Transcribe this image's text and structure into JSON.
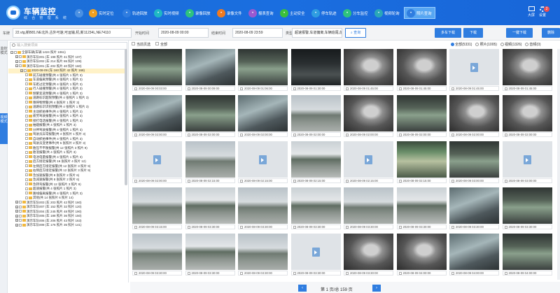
{
  "header": {
    "title": "车辆监控",
    "subtitle": "综 合 管 理 系 统",
    "nav": [
      {
        "label": "",
        "icon": "grid-icon",
        "color": "#4a90e2"
      },
      {
        "label": "实时定位",
        "icon": "location-pin-icon",
        "color": "#f0a020"
      },
      {
        "label": "轨迹回放",
        "icon": "track-icon",
        "color": "#2f7de0"
      },
      {
        "label": "实时视频",
        "icon": "play-icon",
        "color": "#1fb8c4"
      },
      {
        "label": "录像回放",
        "icon": "replay-icon",
        "color": "#2ec27e"
      },
      {
        "label": "录像文件",
        "icon": "file-icon",
        "color": "#f07a20"
      },
      {
        "label": "报表查询",
        "icon": "search-icon",
        "color": "#9b59d0"
      },
      {
        "label": "主动安全",
        "icon": "shield-icon",
        "color": "#3bbf3b"
      },
      {
        "label": "停车轨迹",
        "icon": "parking-icon",
        "color": "#2f9de0"
      },
      {
        "label": "分车监控",
        "icon": "car-monitor-icon",
        "color": "#2ec27e"
      },
      {
        "label": "视频轮询",
        "icon": "carousel-icon",
        "color": "#2aa7b8"
      },
      {
        "label": "照片查询",
        "icon": "camera-icon",
        "color": "#2f7de0"
      }
    ],
    "right": [
      {
        "label": "大屏",
        "icon": "monitor-icon"
      },
      {
        "label": "设置",
        "icon": "gear-icon"
      }
    ],
    "badge": "2"
  },
  "filter": {
    "vehicle_label": "车牌",
    "vehicle_value": "22.vtg,新B81.NE北外,古外可速,可运输,机,新11234L,NE74110 ",
    "start_label": "开始时间",
    "start_value": "2020-08-09  00:00",
    "end_label": "结束时间",
    "end_value": "2020-08-09  23:59",
    "type_label": "类型",
    "type_value": "超速报警,车道偏离,车辆追尾,前 ",
    "query_btn": "查询",
    "actions": [
      "多车下载",
      "下载",
      "一键下载",
      "删除"
    ]
  },
  "sidebar": {
    "tabs": [
      "监控模式",
      "视频模式"
    ],
    "search_placeholder": "输入搜索项目",
    "tree": [
      {
        "text": "全部车辆(车辆 1424 照片 1061)",
        "level": 0,
        "expanded": true
      },
      {
        "text": "演示车队001 (车 198 照片 41 照片 107)",
        "level": 1
      },
      {
        "text": "演示车队002 (车 214 照片 65 照片 109)",
        "level": 1
      },
      {
        "text": "演示车队001 (车 202 照片 40 照片 160)",
        "level": 1,
        "expanded": true
      },
      {
        "text": "2020-08-09 (车 160 照片 42 照片 168)",
        "level": 2,
        "selected": true
      },
      {
        "text": "前方碰撞预警(共 4 张照片 1 照片 3)",
        "level": 3
      },
      {
        "text": "车道偏离预警(共 4 张照片 1 照片 3)",
        "level": 3
      },
      {
        "text": "车距过近预警(共 4 张照片 1 照片 3)",
        "level": 3
      },
      {
        "text": "行人碰撞预警(共 4 张照片 1 照片 3)",
        "level": 3
      },
      {
        "text": "频繁变道预警(共 4 张照片 1 照片 3)",
        "level": 3
      },
      {
        "text": "道路标识超限预警(共 4 张照片 1 照片 3)",
        "level": 3
      },
      {
        "text": "障碍物预警(共 4 张照片 1 照片 3)",
        "level": 3
      },
      {
        "text": "道路标识识别预警(共 4 张照片 1 照片 3)",
        "level": 3
      },
      {
        "text": "主动抓拍事件(共 4 张照片 1 照片 3)",
        "level": 3
      },
      {
        "text": "疲劳驾驶报警(共 6 张照片 1 照片 3)",
        "level": 3
      },
      {
        "text": "接打电话报警(共 4 张照片 1 照片 3)",
        "level": 3
      },
      {
        "text": "抽烟报警(共 4 张照片 1 照片 3)",
        "level": 3
      },
      {
        "text": "分神驾驶报警(共 4 张照片 1 照片 3)",
        "level": 3
      },
      {
        "text": "驾驶员异常报警(共 4 张照片 1 照片 3)",
        "level": 3
      },
      {
        "text": "自动抓拍事件(共 4 张照片 1 照片 3)",
        "level": 3
      },
      {
        "text": "驾驶员变更事件(共 5 张照片 2 照片 3)",
        "level": 3
      },
      {
        "text": "胎压不平衡报警(共 12 张照片 3 照片 9)",
        "level": 3
      },
      {
        "text": "胎温报警(共 4 张照片 1 照片 3)",
        "level": 3
      },
      {
        "text": "电池电量报警(共 4 张照片 1 照片 3)",
        "level": 3
      },
      {
        "text": "后方接近报警(共 16 张照片 4 照片 12)",
        "level": 3
      },
      {
        "text": "左侧后方接近报警(共 12 张照片 3 照片 9)",
        "level": 3
      },
      {
        "text": "右侧后方接近报警(共 12 张照片 3 照片 9)",
        "level": 3
      },
      {
        "text": "急加速报警(共 8 张照片 2 照片 6)",
        "level": 3
      },
      {
        "text": "急减速报警(共 8 张照片 2 照片 6)",
        "level": 3
      },
      {
        "text": "急转弯报警(共 12 张照片 3 照片 9)",
        "level": 3
      },
      {
        "text": "超速报警(共 4 张照片 1 照片 3)",
        "level": 3
      },
      {
        "text": "路线偏离报警(共 4 张照片 1 照片 3)",
        "level": 3
      },
      {
        "text": "其他(共 14 张照片 6 照片 14)",
        "level": 3
      },
      {
        "text": "演示车队003 (车 203 照片 42 照片 160)",
        "level": 1
      },
      {
        "text": "演示车队007 (车 152 照片 32 照片 120)",
        "level": 1
      },
      {
        "text": "演示车队004 (车 245 照片 48 照片 190)",
        "level": 1
      },
      {
        "text": "演示车队005 (车 188 照片 36 照片 150)",
        "level": 1
      },
      {
        "text": "演示车队006 (车 206 照片 43 照片 163)",
        "level": 1
      },
      {
        "text": "演示车队008 (车 176 照片 35 照片 141)",
        "level": 1
      }
    ]
  },
  "content": {
    "select_current": "当前页选",
    "select_all": "全部",
    "radios": [
      "全部(5331)",
      "照片(1005)",
      "视频(1326)",
      "音频(0)"
    ],
    "photos": [
      {
        "time": "2020-08-09 00:03:00",
        "kind": "bus"
      },
      {
        "time": "2020-08-09 00:09:00",
        "kind": "bus2"
      },
      {
        "time": "2020-08-09 01:06:00",
        "kind": "bus"
      },
      {
        "time": "2020-08-09 01:30:00",
        "kind": "night"
      },
      {
        "time": "2020-08-09 01:45:00",
        "kind": "driver"
      },
      {
        "time": "2020-08-09 01:45:00",
        "kind": "driver"
      },
      {
        "time": "2020-08-09 01:45:00",
        "kind": "empty"
      },
      {
        "time": "2020-08-09 01:45:00",
        "kind": "driver"
      },
      {
        "time": "2020-08-09 02:00:00",
        "kind": "bus2"
      },
      {
        "time": "2020-08-09 02:00:00",
        "kind": "bus"
      },
      {
        "time": "2020-08-09 02:00:00",
        "kind": "bus2"
      },
      {
        "time": "2020-08-09 02:00:00",
        "kind": "road"
      },
      {
        "time": "2020-08-09 02:00:00",
        "kind": "driver"
      },
      {
        "time": "2020-08-09 02:00:00",
        "kind": "bus"
      },
      {
        "time": "2020-08-09 02:00:00",
        "kind": "driver"
      },
      {
        "time": "2020-08-09 02:00:00",
        "kind": "driver"
      },
      {
        "time": "2020-08-09 02:00:00",
        "kind": "empty"
      },
      {
        "time": "2020-08-09 02:15:00",
        "kind": "road"
      },
      {
        "time": "2020-08-09 02:15:00",
        "kind": "empty"
      },
      {
        "time": "2020-08-09 02:15:00",
        "kind": "road2"
      },
      {
        "time": "2020-08-09 02:15:00",
        "kind": "empty"
      },
      {
        "time": "2020-08-09 02:15:00",
        "kind": "color"
      },
      {
        "time": "2020-08-09 03:00:00",
        "kind": "bus"
      },
      {
        "time": "2020-08-09 03:00:00",
        "kind": "empty"
      },
      {
        "time": "2020-08-09 03:15:00",
        "kind": "road"
      },
      {
        "time": "2020-08-09 03:30:00",
        "kind": "road2"
      },
      {
        "time": "2020-08-09 03:30:00",
        "kind": "road"
      },
      {
        "time": "2020-08-09 03:30:00",
        "kind": "road2"
      },
      {
        "time": "2020-08-09 03:30:00",
        "kind": "road"
      },
      {
        "time": "2020-08-09 03:30:00",
        "kind": "road2"
      },
      {
        "time": "2020-08-09 03:30:00",
        "kind": "bus2"
      },
      {
        "time": "2020-08-09 03:30:00",
        "kind": "bus"
      },
      {
        "time": "2020-08-09 03:30:00",
        "kind": "road"
      },
      {
        "time": "2020-08-09 03:30:00",
        "kind": "road2"
      },
      {
        "time": "2020-08-09 03:30:00",
        "kind": "road"
      },
      {
        "time": "2020-08-09 03:30:00",
        "kind": "empty"
      },
      {
        "time": "2020-08-09 03:30:00",
        "kind": "driver"
      },
      {
        "time": "2020-08-09 04:00:00",
        "kind": "driver"
      },
      {
        "time": "2020-08-09 04:00:00",
        "kind": "bus2"
      },
      {
        "time": "2020-08-09 04:00:00",
        "kind": "bus"
      }
    ]
  },
  "pager": {
    "text": "第 1 页/总 159 页",
    "prev": "‹",
    "next": "›"
  }
}
